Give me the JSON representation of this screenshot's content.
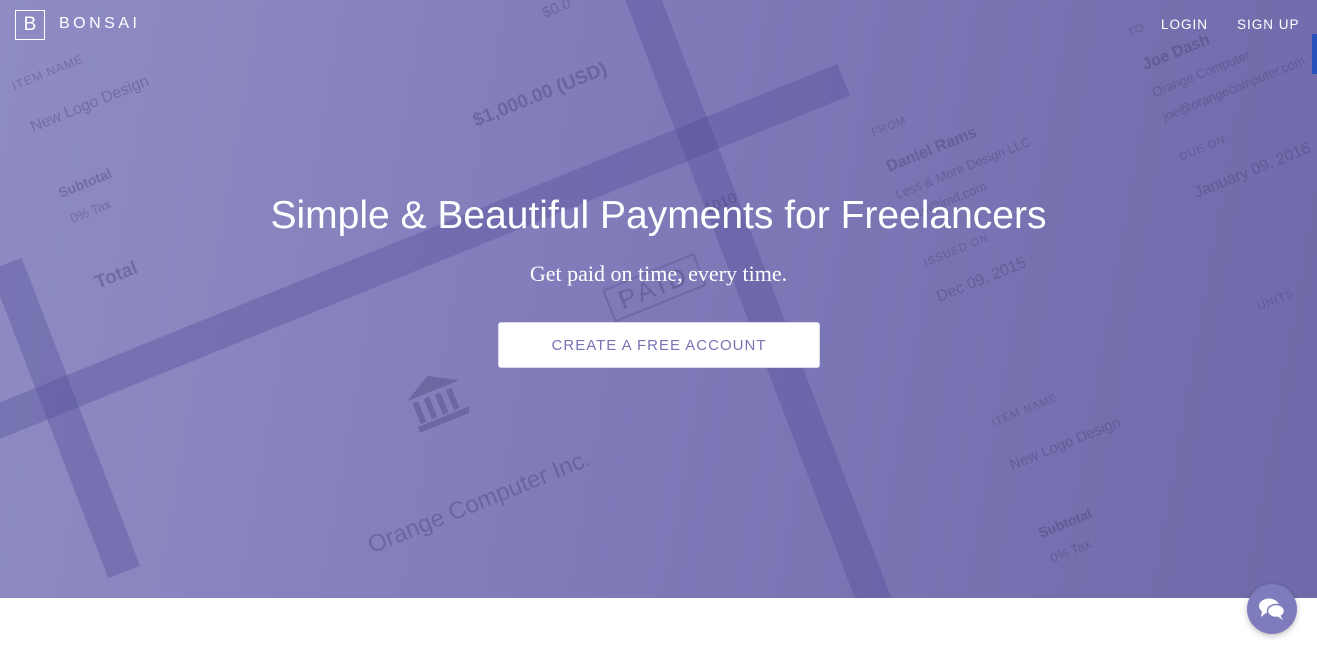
{
  "nav": {
    "logo_letter": "B",
    "brand": "BONSAI",
    "login_label": "LOGIN",
    "signup_label": "SIGN UP"
  },
  "hero": {
    "headline": "Simple & Beautiful Payments for Freelancers",
    "subheadline": "Get paid on time, every time.",
    "cta_label": "CREATE A FREE ACCOUNT"
  },
  "background_invoice": {
    "item_name_label": "ITEM NAME",
    "item_name": "New Logo Design",
    "amount": "$1,000.00 (USD)",
    "amount_top": "$0.0",
    "subtotal_label": "Subtotal",
    "tax_label": "0% Tax",
    "total_label": "Total",
    "invoice_number": "1010",
    "paid_stamp": "PAID",
    "company": "Orange Computer Inc.",
    "from_label": "FROM",
    "from_name": "Daniel Rams",
    "from_company": "Less & More Design LLC",
    "from_email": "dan@lmd.com",
    "issued_label": "ISSUED ON",
    "issued_date": "Dec 09, 2015",
    "to_label": "TO",
    "to_name": "Joe Dash",
    "to_company": "Orange Computer",
    "to_email": "joe@orangecomputer.com",
    "due_label": "DUE ON",
    "due_date": "January 09, 2016",
    "units_label": "UNITS",
    "item_name_label_2": "ITEM NAME",
    "item_name_2": "New Logo Design",
    "subtotal_label_2": "Subtotal",
    "tax_label_2": "0% Tax"
  },
  "colors": {
    "hero_start": "#8f8cc4",
    "hero_end": "#6f6aa9",
    "cta_text": "#7774b4",
    "chat_button": "#7f7cbd",
    "side_tab": "#2a52be"
  },
  "icons": {
    "chat": "chat-bubbles-icon",
    "bank": "bank-building-icon"
  }
}
